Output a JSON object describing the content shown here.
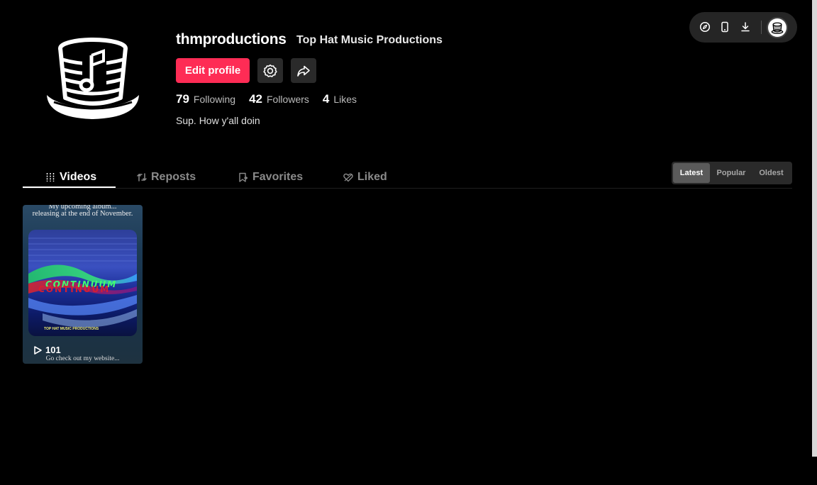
{
  "profile": {
    "username": "thmproductions",
    "nickname": "Top Hat Music Productions",
    "edit_label": "Edit profile",
    "bio": "Sup. How y'all doin",
    "stats": [
      {
        "num": "79",
        "label": "Following"
      },
      {
        "num": "42",
        "label": "Followers"
      },
      {
        "num": "4",
        "label": "Likes"
      }
    ]
  },
  "tabs": [
    {
      "label": "Videos",
      "icon": "grid-icon",
      "active": true
    },
    {
      "label": "Reposts",
      "icon": "repost-icon"
    },
    {
      "label": "Favorites",
      "icon": "bookmark-icon"
    },
    {
      "label": "Liked",
      "icon": "heart-icon"
    }
  ],
  "sort": {
    "options": [
      "Latest",
      "Popular",
      "Oldest"
    ],
    "selected": "Latest"
  },
  "videos": [
    {
      "top_line_1": "My upcoming album...",
      "top_line_2": "releasing at the end of November.",
      "art_title": "CONTINUUM",
      "art_subtitle": "TOP HAT MUSIC PRODUCTIONS",
      "views": "101",
      "caption": "Go check out my website..."
    }
  ],
  "colors": {
    "accent": "#fe2c55",
    "background": "#000000"
  }
}
